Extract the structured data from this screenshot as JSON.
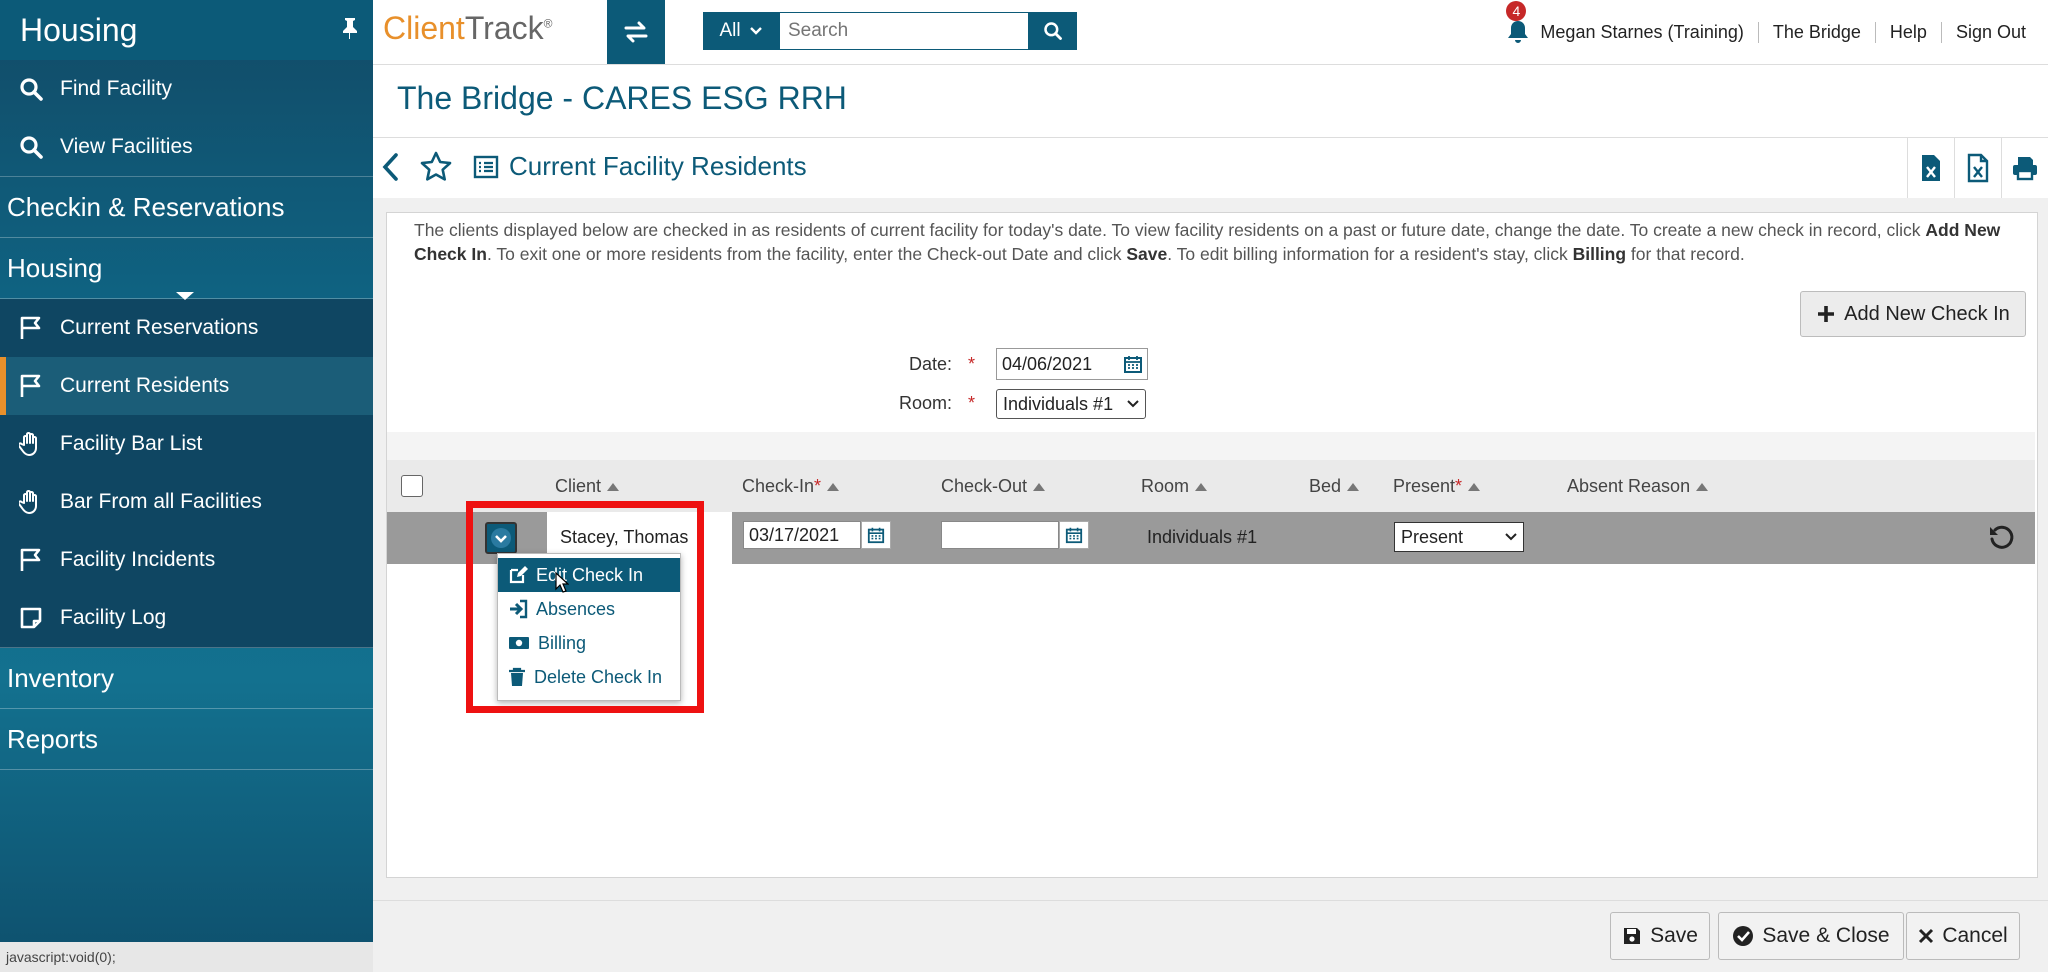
{
  "sidebar": {
    "header": "Housing",
    "top_items": [
      {
        "label": "Find Facility",
        "icon": "search-icon"
      },
      {
        "label": "View Facilities",
        "icon": "search-icon"
      }
    ],
    "categories": {
      "checkin": "Checkin & Reservations",
      "housing": "Housing",
      "inventory": "Inventory",
      "reports": "Reports"
    },
    "housing_items": [
      {
        "label": "Current Reservations",
        "icon": "flag-icon"
      },
      {
        "label": "Current Residents",
        "icon": "flag-icon",
        "active": true
      },
      {
        "label": "Facility Bar List",
        "icon": "hand-icon"
      },
      {
        "label": "Bar From all Facilities",
        "icon": "hand-icon"
      },
      {
        "label": "Facility Incidents",
        "icon": "flag-icon"
      },
      {
        "label": "Facility Log",
        "icon": "note-icon"
      }
    ]
  },
  "status_bar": "javascript:void(0);",
  "topbar": {
    "logo_c": "C",
    "logo_lient": "lient",
    "logo_track": "Track",
    "logo_reg": "®",
    "search_scope": "All",
    "search_placeholder": "Search",
    "notification_count": "4",
    "user": "Megan Starnes (Training)",
    "links": [
      "The Bridge",
      "Help",
      "Sign Out"
    ]
  },
  "page_title": "The Bridge - CARES ESG RRH",
  "subheader_title": "Current Facility Residents",
  "instructions": {
    "p1": "The clients displayed below are checked in as residents of current facility for today's date.  To view facility residents on a past or future date, change the date.  To create a new check in record, click ",
    "b1": "Add New Check In",
    "p2": ".  To exit one or more residents from the facility, enter the Check-out Date and click ",
    "b2": "Save",
    "p3": ".  To edit billing information for a resident's stay, click ",
    "b3": "Billing",
    "p4": " for that record."
  },
  "add_new_label": "Add New Check In",
  "form": {
    "date_label": "Date:",
    "date_value": "04/06/2021",
    "room_label": "Room:",
    "room_value": "Individuals #1",
    "required_mark": "*"
  },
  "grid": {
    "columns": [
      "Client",
      "Check-In",
      "Check-Out",
      "Room",
      "Bed",
      "Present",
      "Absent Reason"
    ],
    "row": {
      "client": "Stacey, Thomas",
      "check_in": "03/17/2021",
      "check_out": "",
      "room": "Individuals #1",
      "bed": "",
      "present": "Present",
      "absent_reason": ""
    }
  },
  "menu": {
    "items": [
      {
        "label": "Edit Check In",
        "icon": "edit-icon"
      },
      {
        "label": "Absences",
        "icon": "sign-in-icon"
      },
      {
        "label": "Billing",
        "icon": "money-icon"
      },
      {
        "label": "Delete Check In",
        "icon": "trash-icon"
      }
    ]
  },
  "footer": {
    "save": "Save",
    "save_close": "Save & Close",
    "cancel": "Cancel"
  },
  "colors": {
    "primary": "#0c5a78",
    "accent": "#e8902b",
    "highlight": "#ee1111",
    "required": "#c62828"
  }
}
